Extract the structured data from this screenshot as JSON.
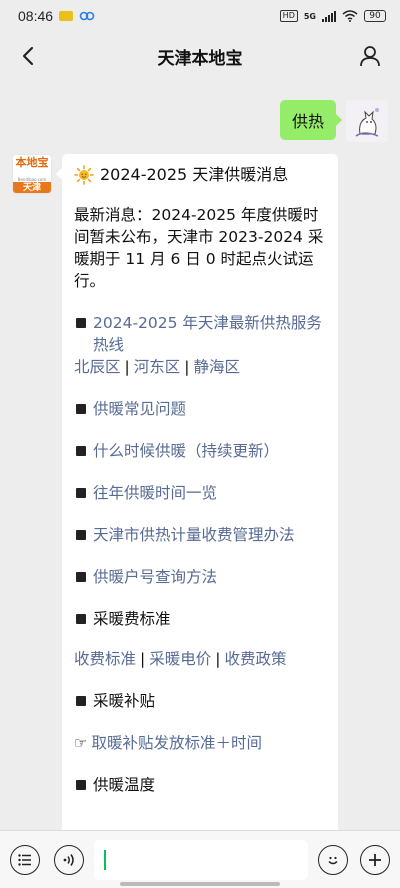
{
  "status_bar": {
    "time": "08:46",
    "network": "5G",
    "battery": "90"
  },
  "nav": {
    "title": "天津本地宝"
  },
  "user_message": {
    "text": "供热"
  },
  "bot": {
    "logo_text_top": "本地宝",
    "logo_text_mid": "Bendibao.com",
    "logo_text_bottom": "天津"
  },
  "bot_message": {
    "title": "2024-2025 天津供暖消息",
    "intro": "最新消息：2024-2025 年度供暖时间暂未公布，天津市 2023-2024 采暖期于 11 月 6 日 0 时起点火试运行。",
    "hotline": {
      "label": "2024-2025 年天津最新供热服务热线",
      "districts": [
        "北辰区",
        "河东区",
        "静海区"
      ]
    },
    "faq": "供暖常见问题",
    "when_heating": "什么时候供暖（持续更新）",
    "past_times": "往年供暖时间一览",
    "metering": "天津市供热计量收费管理办法",
    "account_query": "供暖户号查询方法",
    "fee_standard": "采暖费标准",
    "fee_links": [
      "收费标准",
      "采暖电价",
      "收费政策"
    ],
    "subsidy": "采暖补贴",
    "subsidy_link": "取暖补贴发放标准＋时间",
    "temperature": "供暖温度",
    "accent_link_color": "#576b95"
  },
  "input": {
    "value": ""
  }
}
